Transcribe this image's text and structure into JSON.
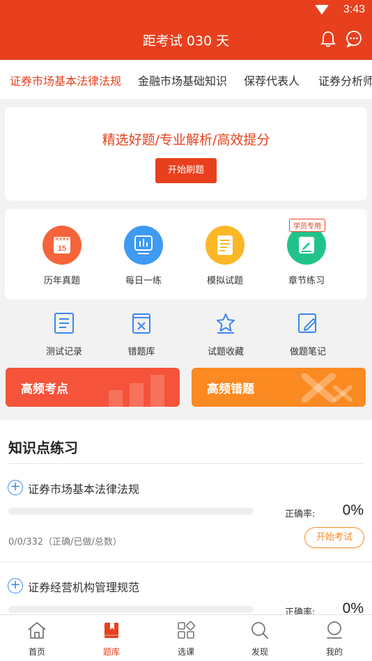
{
  "status": {
    "time": "3:43"
  },
  "header": {
    "title": "距考试 030 天"
  },
  "tabs": [
    {
      "label": "证券市场基本法律法规",
      "active": true
    },
    {
      "label": "金融市场基础知识",
      "active": false
    },
    {
      "label": "保荐代表人",
      "active": false
    },
    {
      "label": "证券分析师",
      "active": false
    }
  ],
  "banner": {
    "slogan": "精选好题/专业解析/高效提分",
    "button": "开始刷题"
  },
  "features": [
    {
      "label": "历年真题",
      "icon": "calendar-icon",
      "color": "#f5643a",
      "day": "15"
    },
    {
      "label": "每日一练",
      "icon": "chart-board-icon",
      "color": "#3e9af2"
    },
    {
      "label": "模拟试题",
      "icon": "document-icon",
      "color": "#fbb726"
    },
    {
      "label": "章节练习",
      "icon": "pencil-note-icon",
      "color": "#22c38a",
      "badge": "学员专用"
    }
  ],
  "tools": [
    {
      "label": "测试记录",
      "icon": "list-icon"
    },
    {
      "label": "错题库",
      "icon": "wrong-book-icon"
    },
    {
      "label": "试题收藏",
      "icon": "star-icon"
    },
    {
      "label": "做题笔记",
      "icon": "edit-note-icon"
    }
  ],
  "hot": {
    "points": "高频考点",
    "mistakes": "高频错题",
    "points_color": "#f5533a",
    "mistakes_color": "#fb8a22"
  },
  "knowledge": {
    "heading": "知识点练习",
    "accuracy_label": "正确率:",
    "items": [
      {
        "name": "证券市场基本法律法规",
        "accuracy": "0%",
        "progress": 0,
        "stats": "0/0/332（正确/已做/总数）",
        "button": "开始考试"
      },
      {
        "name": "证券经营机构管理规范",
        "accuracy": "0%",
        "progress": 0
      }
    ]
  },
  "nav": [
    {
      "label": "首页",
      "icon": "home-icon",
      "active": false
    },
    {
      "label": "题库",
      "icon": "question-bank-icon",
      "active": true
    },
    {
      "label": "选课",
      "icon": "course-grid-icon",
      "active": false
    },
    {
      "label": "发现",
      "icon": "discover-search-icon",
      "active": false
    },
    {
      "label": "我的",
      "icon": "profile-icon",
      "active": false
    }
  ],
  "colors": {
    "brand": "#e8401d",
    "accent_blue": "#3b86f0",
    "accent_orange": "#fb8a22"
  }
}
